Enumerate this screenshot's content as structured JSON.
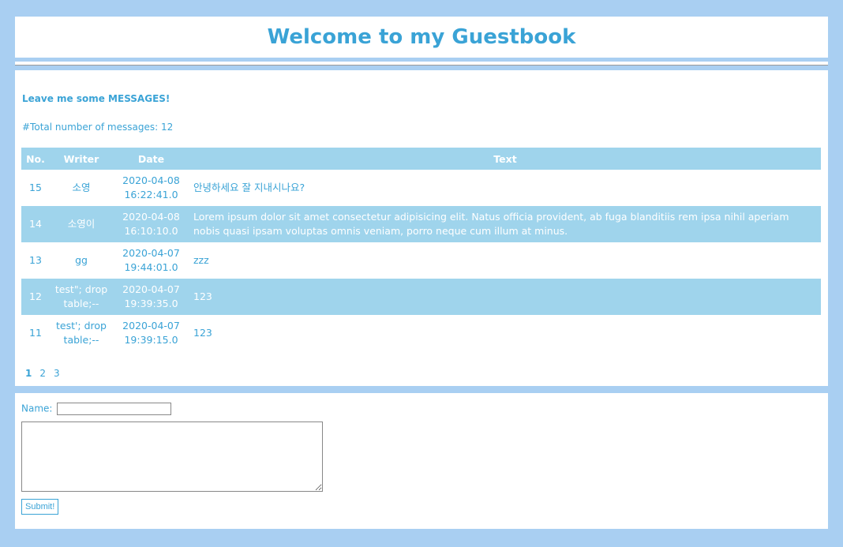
{
  "header": {
    "title": "Welcome to my Guestbook"
  },
  "messages": {
    "lead": "Leave me some MESSAGES!",
    "total_text": "#Total number of messages: 12",
    "columns": [
      "No.",
      "Writer",
      "Date",
      "Text"
    ],
    "rows": [
      {
        "no": "15",
        "writer": "소영",
        "date_day": "2020-04-08",
        "date_time": "16:22:41.0",
        "text": "안녕하세요 잘 지내시나요?"
      },
      {
        "no": "14",
        "writer": "소영이",
        "date_day": "2020-04-08",
        "date_time": "16:10:10.0",
        "text": "Lorem ipsum dolor sit amet consectetur adipisicing elit. Natus officia provident, ab fuga blanditiis rem ipsa nihil aperiam nobis quasi ipsam voluptas omnis veniam, porro neque cum illum at minus."
      },
      {
        "no": "13",
        "writer": "gg",
        "date_day": "2020-04-07",
        "date_time": "19:44:01.0",
        "text": "zzz"
      },
      {
        "no": "12",
        "writer": "test\"; drop table;--",
        "date_day": "2020-04-07",
        "date_time": "19:39:35.0",
        "text": "123"
      },
      {
        "no": "11",
        "writer": "test'; drop table;--",
        "date_day": "2020-04-07",
        "date_time": "19:39:15.0",
        "text": "123"
      }
    ],
    "pages": [
      "1",
      "2",
      "3"
    ],
    "current_page": "1"
  },
  "form": {
    "name_label": "Name:",
    "name_value": "",
    "message_value": "",
    "submit_label": "Submit!"
  },
  "colors": {
    "background": "#a9cff2",
    "accent": "#3aa3d6",
    "row_highlight": "#9fd4ec"
  }
}
